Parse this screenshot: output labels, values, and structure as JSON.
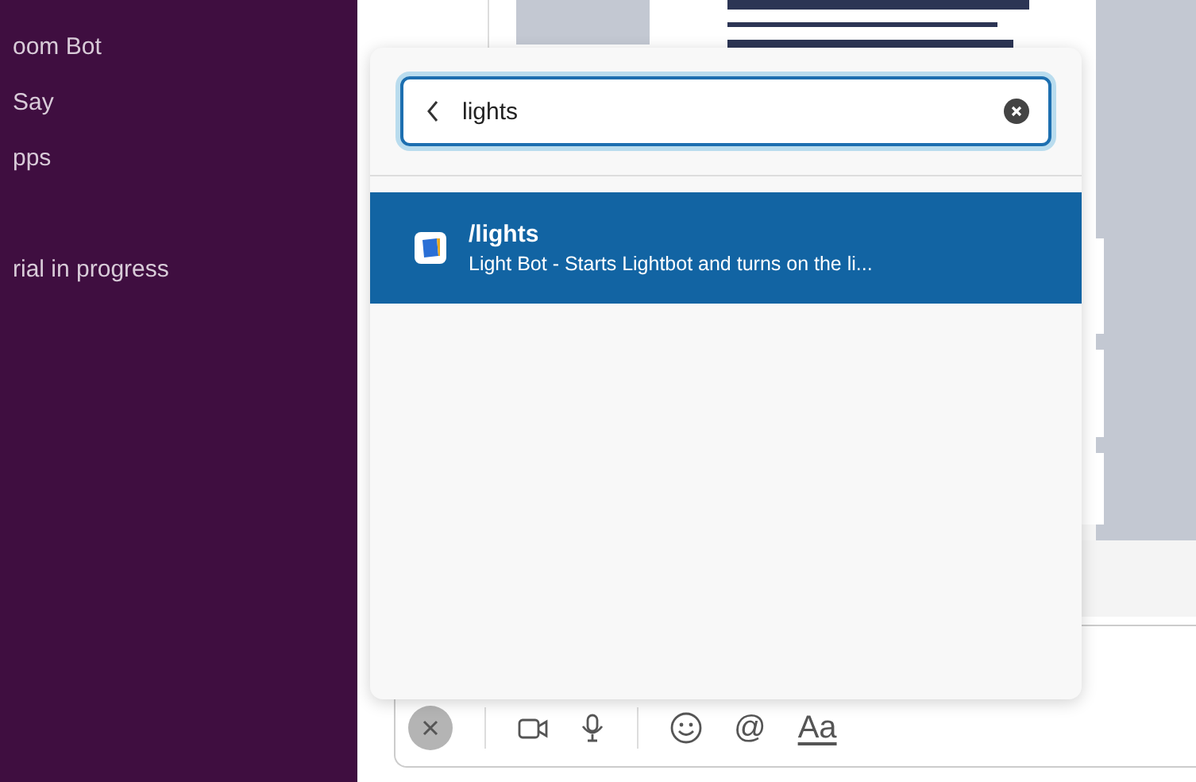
{
  "sidebar": {
    "items": [
      {
        "label": "oom Bot"
      },
      {
        "label": "Say"
      },
      {
        "label": "pps"
      },
      {
        "label": "rial in progress"
      }
    ]
  },
  "command_popup": {
    "search": {
      "value": "lights"
    },
    "results": [
      {
        "command": "/lights",
        "description": "Light Bot - Starts Lightbot and turns on the li...",
        "selected": true
      }
    ]
  },
  "composer": {
    "toolbar": [
      {
        "kind": "close"
      },
      {
        "kind": "divider"
      },
      {
        "kind": "video"
      },
      {
        "kind": "mic"
      },
      {
        "kind": "divider"
      },
      {
        "kind": "emoji"
      },
      {
        "kind": "mention",
        "label": "@"
      },
      {
        "kind": "format",
        "label": "Aa"
      }
    ]
  }
}
